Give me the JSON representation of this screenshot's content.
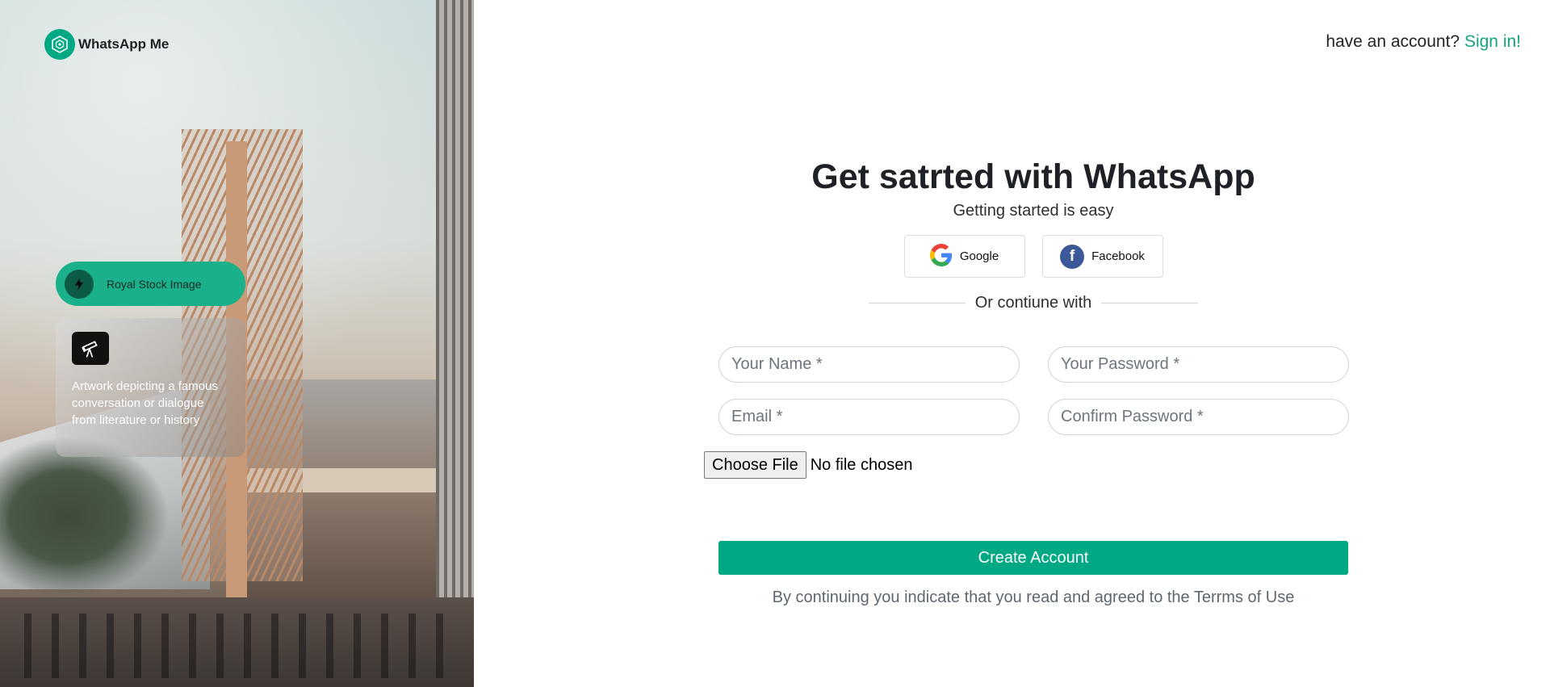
{
  "brand": {
    "name": "WhatsApp Me",
    "logo_icon": "hexagon-logo-icon",
    "color": "#00a884"
  },
  "left_panel": {
    "pill_label": "Royal Stock Image",
    "pill_icon": "lightning-bolt-icon",
    "card_icon": "telescope-icon",
    "card_text": "Artwork depicting a famous conversation or dialogue from literature or history"
  },
  "header": {
    "prompt": "have an account?",
    "signin_link": "Sign in!"
  },
  "form": {
    "title": "Get satrted with WhatsApp",
    "subtitle": "Getting started is easy",
    "social": [
      {
        "label": "Google",
        "icon": "google-icon"
      },
      {
        "label": "Facebook",
        "icon": "facebook-icon"
      }
    ],
    "divider": "Or contiune with",
    "fields": {
      "name_placeholder": "Your Name *",
      "password_placeholder": "Your Password *",
      "email_placeholder": "Email *",
      "confirm_placeholder": "Confirm Password *"
    },
    "file": {
      "button_label": "Choose File",
      "status": "No file chosen"
    },
    "submit_label": "Create Account",
    "terms": "By continuing you indicate that you read and agreed to the Terrms of Use"
  },
  "colors": {
    "accent": "#00a884",
    "link": "#14a37f",
    "facebook": "#3b5998"
  }
}
